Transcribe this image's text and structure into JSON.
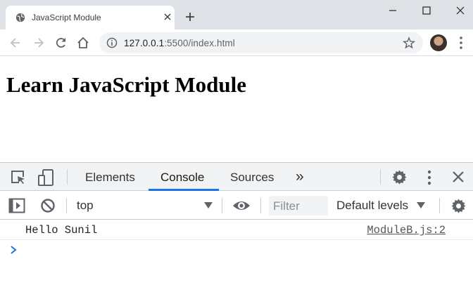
{
  "browser": {
    "tab_title": "JavaScript Module",
    "url_host": "127.0.0.1",
    "url_rest": ":5500/index.html"
  },
  "page": {
    "heading": "Learn JavaScript Module"
  },
  "devtools": {
    "tabs": [
      {
        "label": "Elements",
        "active": false
      },
      {
        "label": "Console",
        "active": true
      },
      {
        "label": "Sources",
        "active": false
      }
    ],
    "more_tabs": "»",
    "console": {
      "context": "top",
      "filter_placeholder": "Filter",
      "levels": "Default levels"
    },
    "logs": [
      {
        "message": "Hello Sunil",
        "source": "ModuleB.js:2"
      }
    ]
  },
  "colors": {
    "accent": "#1a73e8",
    "tabstrip": "#dee1e6",
    "devtools_bar": "#f1f3f4"
  }
}
